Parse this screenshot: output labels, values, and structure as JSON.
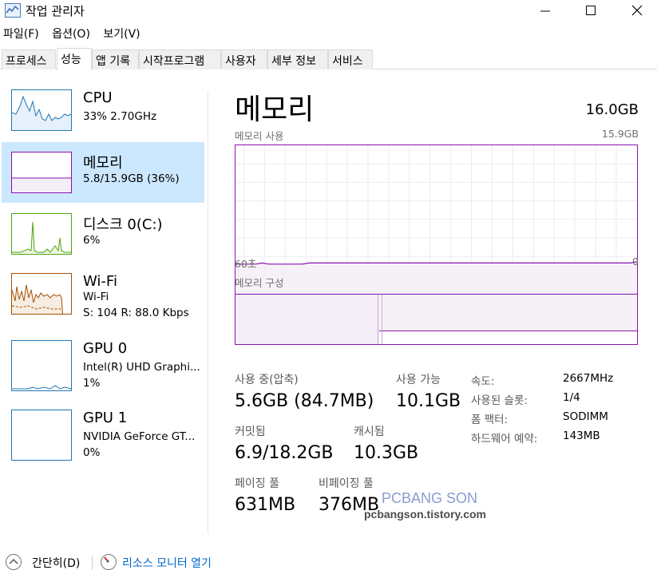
{
  "window": {
    "title": "작업 관리자"
  },
  "menu": [
    "파일(F)",
    "옵션(O)",
    "보기(V)"
  ],
  "tabs": [
    "프로세스",
    "성능",
    "앱 기록",
    "시작프로그램",
    "사용자",
    "세부 정보",
    "서비스"
  ],
  "sidebar": [
    {
      "title": "CPU",
      "line1": "33%  2.70GHz",
      "line2": ""
    },
    {
      "title": "메모리",
      "line1": "5.8/15.9GB (36%)",
      "line2": ""
    },
    {
      "title": "디스크 0(C:)",
      "line1": "6%",
      "line2": ""
    },
    {
      "title": "Wi-Fi",
      "line1": "Wi-Fi",
      "line2": "S: 104  R: 88.0 Kbps"
    },
    {
      "title": "GPU 0",
      "line1": "Intel(R) UHD Graphi...",
      "line2": "1%"
    },
    {
      "title": "GPU 1",
      "line1": "NVIDIA GeForce GT...",
      "line2": "0%"
    }
  ],
  "main": {
    "title": "메모리",
    "total": "16.0GB",
    "usage_label": "메모리 사용",
    "usage_max": "15.9GB",
    "x_left": "60초",
    "x_right": "0",
    "composition_label": "메모리 구성",
    "stats": {
      "in_use_label": "사용 중(압축)",
      "in_use_value": "5.6GB (84.7MB)",
      "available_label": "사용 가능",
      "available_value": "10.1GB",
      "committed_label": "커밋됨",
      "committed_value": "6.9/18.2GB",
      "cached_label": "캐시됨",
      "cached_value": "10.3GB",
      "paged_label": "페이징 풀",
      "paged_value": "631MB",
      "nonpaged_label": "비페이징 풀",
      "nonpaged_value": "376MB"
    },
    "details": [
      {
        "label": "속도:",
        "value": "2667MHz"
      },
      {
        "label": "사용된 슬롯:",
        "value": "1/4"
      },
      {
        "label": "폼 팩터:",
        "value": "SODIMM"
      },
      {
        "label": "하드웨어 예약:",
        "value": "143MB"
      }
    ]
  },
  "watermark": {
    "line1": "PCBANG SON",
    "line2": "pcbangson.tistory.com"
  },
  "footer": {
    "collapse": "간단히(D)",
    "monitor": "리소스 모니터 열기"
  },
  "colors": {
    "cpu": "#1f77b4",
    "memory": "#8b12ae",
    "disk": "#4da60c",
    "wifi": "#a74f01",
    "gpu": "#1f77b4",
    "selected_bg": "#cce8ff"
  },
  "chart_data": {
    "type": "area",
    "title": "메모리 사용",
    "x_range": [
      "60초",
      "0"
    ],
    "ylim": [
      0,
      15.9
    ],
    "series": [
      {
        "values": [
          5.7,
          5.7,
          5.7,
          5.7,
          5.8,
          5.7,
          5.7,
          5.7,
          5.7,
          5.7,
          5.7,
          5.8,
          5.8,
          5.8,
          5.8,
          5.8,
          5.8,
          5.8,
          5.8,
          5.8,
          5.8,
          5.8,
          5.8,
          5.8,
          5.8,
          5.8,
          5.8,
          5.8,
          5.8,
          5.8,
          5.8,
          5.8,
          5.8,
          5.8,
          5.8,
          5.8,
          5.8,
          5.8,
          5.8,
          5.8,
          5.8,
          5.8,
          5.8,
          5.8,
          5.8,
          5.8,
          5.8,
          5.8,
          5.8,
          5.8,
          5.8,
          5.8,
          5.8,
          5.8,
          5.8,
          5.8,
          5.8,
          5.8,
          5.8,
          5.8,
          5.9
        ]
      }
    ]
  }
}
